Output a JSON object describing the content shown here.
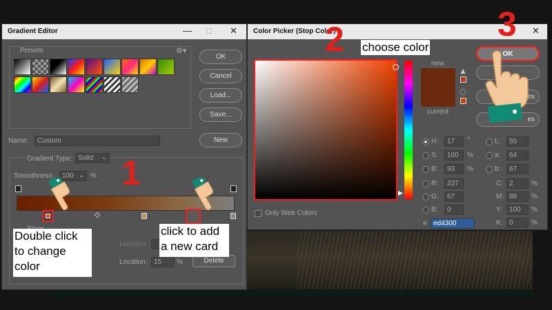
{
  "gradient_editor": {
    "title": "Gradient Editor",
    "presets_label": "Presets",
    "buttons": {
      "ok": "OK",
      "cancel": "Cancel",
      "load": "Load...",
      "save": "Save...",
      "new": "New"
    },
    "name_label": "Name:",
    "name_value": "Custom",
    "gradient_type_label": "Gradient Type:",
    "gradient_type_value": "Solid",
    "smoothness_label": "Smoothness:",
    "smoothness_value": "100",
    "smoothness_unit": "%",
    "stops_label": "Stops",
    "location_label_1": "Location:",
    "location_label_2": "Location:",
    "location_value": "15",
    "location_unit": "%",
    "delete_label": "Delete",
    "gradient_colors": {
      "start": "#6b1f00",
      "mid": "#8a6a45",
      "end": "#7d7d7d"
    }
  },
  "color_picker": {
    "title": "Color Picker (Stop Color)",
    "ok_label": "OK",
    "partial_labels": {
      "add_to_swatches": "ches",
      "color_libraries": "es"
    },
    "new_label": "new",
    "current_label": "current",
    "new_color": "#6b2a0e",
    "current_color": "#6b2a0e",
    "picked_color": "#ed4300",
    "only_web_colors": "Only Web Colors",
    "hsb": [
      {
        "label": "H:",
        "value": "17",
        "unit": "°",
        "selected": true
      },
      {
        "label": "S:",
        "value": "100",
        "unit": "%",
        "selected": false
      },
      {
        "label": "B:",
        "value": "93",
        "unit": "%",
        "selected": false
      }
    ],
    "rgb": [
      {
        "label": "R:",
        "value": "237"
      },
      {
        "label": "G:",
        "value": "67"
      },
      {
        "label": "B:",
        "value": "0"
      }
    ],
    "lab": [
      {
        "label": "L:",
        "value": "55"
      },
      {
        "label": "a:",
        "value": "64"
      },
      {
        "label": "b:",
        "value": "67"
      }
    ],
    "cmyk": [
      {
        "label": "C:",
        "value": "2",
        "unit": "%"
      },
      {
        "label": "M:",
        "value": "88",
        "unit": "%"
      },
      {
        "label": "Y:",
        "value": "100",
        "unit": "%"
      },
      {
        "label": "K:",
        "value": "0",
        "unit": "%"
      }
    ],
    "hex_label": "#",
    "hex_value": "ed4300"
  },
  "annotations": {
    "step1": "1",
    "step2": "2",
    "step3": "3",
    "note_choose": "choose color",
    "note_double_click": "Double click to change color",
    "note_add_card": "click to add a new card"
  },
  "colors": {
    "annotation_red": "#e2211c",
    "highlight_border": "#ff1a1a"
  }
}
